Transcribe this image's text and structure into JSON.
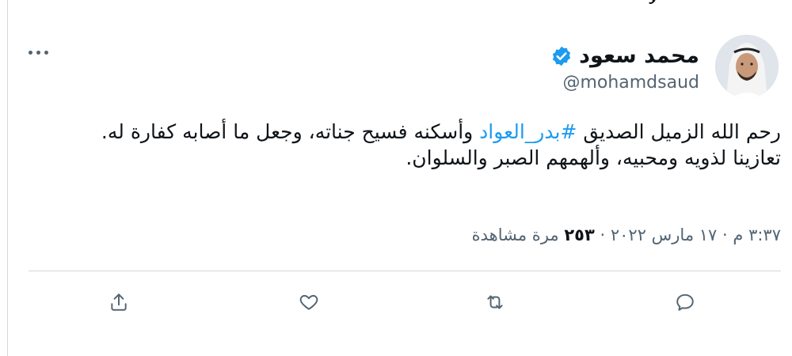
{
  "top_fragment": "لا",
  "author": {
    "display_name": "محمد سعود",
    "handle": "@mohamdsaud",
    "verified": true
  },
  "tweet": {
    "line1_before": "رحم الله الزميل الصديق",
    "hashtag": "#بدر_العواد",
    "line1_after": "وأسكنه فسيح جناته، وجعل ما أصابه كفارة له.",
    "line2": "تعازينا لذويه ومحبيه، وألهمهم الصبر والسلوان."
  },
  "meta": {
    "time": "٣:٣٧ م",
    "separator": "·",
    "date": "١٧ مارس ٢٠٢٢",
    "views_count": "٢٥٣",
    "views_label": "مرة مشاهدة"
  },
  "actions": {
    "reply_icon": "reply-icon",
    "retweet_icon": "retweet-icon",
    "like_icon": "heart-icon",
    "share_icon": "share-icon"
  },
  "colors": {
    "accent": "#1d9bf0",
    "secondary_text": "#536471",
    "divider": "#cfd9de"
  }
}
